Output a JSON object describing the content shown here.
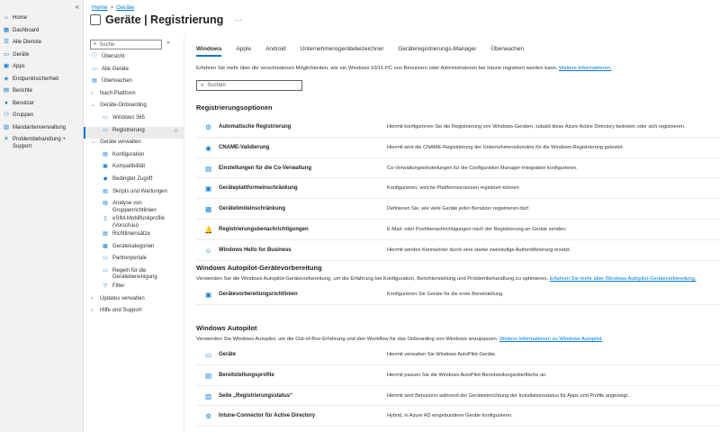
{
  "leftnav": {
    "items": [
      {
        "label": "Home",
        "icon": "home-icon",
        "glyph": "⌂"
      },
      {
        "label": "Dashboard",
        "icon": "dashboard-icon",
        "glyph": "▦"
      },
      {
        "label": "Alle Dienste",
        "icon": "all-services-icon",
        "glyph": "☰"
      },
      {
        "label": "Geräte",
        "icon": "devices-icon",
        "glyph": "▭"
      },
      {
        "label": "Apps",
        "icon": "apps-icon",
        "glyph": "▣"
      },
      {
        "label": "Endpunktsicherheit",
        "icon": "endpoint-security-icon",
        "glyph": "◈"
      },
      {
        "label": "Berichte",
        "icon": "reports-icon",
        "glyph": "▤"
      },
      {
        "label": "Benutzer",
        "icon": "users-icon",
        "glyph": "●"
      },
      {
        "label": "Gruppen",
        "icon": "groups-icon",
        "glyph": "⚇"
      },
      {
        "label": "Mandantenverwaltung",
        "icon": "tenant-admin-icon",
        "glyph": "▥"
      },
      {
        "label": "Problembehandlung + Support",
        "icon": "troubleshooting-icon",
        "glyph": "✕"
      }
    ]
  },
  "breadcrumb": {
    "home": "Home",
    "sep": ">",
    "current": "Geräte"
  },
  "page": {
    "title": "Geräte | Registrierung",
    "more": "···"
  },
  "subnav": {
    "search_placeholder": "Suche",
    "collapse": "«",
    "items": [
      {
        "label": "Übersicht",
        "icon": "overview-icon",
        "glyph": "ⓘ",
        "level": 1
      },
      {
        "label": "Alle Geräte",
        "icon": "all-devices-icon",
        "glyph": "▭",
        "level": 1
      },
      {
        "label": "Überwachen",
        "icon": "monitor-icon",
        "glyph": "▤",
        "level": 1
      },
      {
        "label": "Nach Plattform",
        "icon": "chevron-right-icon",
        "glyph": "›",
        "level": 1,
        "chev": true
      },
      {
        "label": "Geräte-Onboarding",
        "icon": "chevron-down-icon",
        "glyph": "⌄",
        "level": 1,
        "chev": true
      },
      {
        "label": "Windows 365",
        "icon": "windows365-icon",
        "glyph": "▭",
        "level": 2
      },
      {
        "label": "Registrierung",
        "icon": "enrollment-icon",
        "glyph": "▭",
        "level": 2,
        "selected": true,
        "star": "☆"
      },
      {
        "label": "Geräte verwalten",
        "icon": "chevron-down-icon",
        "glyph": "⌄",
        "level": 1,
        "chev": true
      },
      {
        "label": "Konfiguration",
        "icon": "configuration-icon",
        "glyph": "▤",
        "level": 2
      },
      {
        "label": "Kompatibilität",
        "icon": "compliance-icon",
        "glyph": "▣",
        "level": 2
      },
      {
        "label": "Bedingter Zugriff",
        "icon": "conditional-access-icon",
        "glyph": "◆",
        "level": 2
      },
      {
        "label": "Skripts und Wartungen",
        "icon": "scripts-icon",
        "glyph": "▤",
        "level": 2
      },
      {
        "label": "Analyse von Gruppenrichtlinien",
        "icon": "gpo-analytics-icon",
        "glyph": "▤",
        "level": 2
      },
      {
        "label": "eSIM-Mobilfunkprofile (Vorschau)",
        "icon": "esim-icon",
        "glyph": "▯",
        "level": 2
      },
      {
        "label": "Richtliniensätze",
        "icon": "policy-sets-icon",
        "glyph": "▤",
        "level": 2
      },
      {
        "label": "Gerätekategorien",
        "icon": "device-categories-icon",
        "glyph": "▦",
        "level": 2
      },
      {
        "label": "Partnerportale",
        "icon": "partner-portals-icon",
        "glyph": "▭",
        "level": 2
      },
      {
        "label": "Regeln für die Gerätebereinigung",
        "icon": "cleanup-rules-icon",
        "glyph": "▭",
        "level": 2
      },
      {
        "label": "Filter",
        "icon": "filter-icon",
        "glyph": "▽",
        "level": 2
      },
      {
        "label": "Updates verwalten",
        "icon": "chevron-right-icon",
        "glyph": "›",
        "level": 1,
        "chev": true
      },
      {
        "label": "Hilfe und Support",
        "icon": "chevron-right-icon",
        "glyph": "›",
        "level": 1,
        "chev": true
      }
    ]
  },
  "tabs": [
    {
      "label": "Windows",
      "active": true
    },
    {
      "label": "Apple"
    },
    {
      "label": "Android"
    },
    {
      "label": "Unternehmensgerätebezeichner"
    },
    {
      "label": "Geräteregistrierungs-Manager"
    },
    {
      "label": "Überwachen"
    }
  ],
  "intro": {
    "text": "Erfahren Sie mehr über die verschiedenen Möglichkeiten, wie ein Windows 10/11-PC von Benutzern oder Administratoren bei Intune registriert werden kann. ",
    "link": "Weitere Informationen."
  },
  "content_search": {
    "placeholder": "Suchen"
  },
  "sections": [
    {
      "title": "Registrierungsoptionen",
      "rows": [
        {
          "name": "Automatische Registrierung",
          "desc": "Hiermit konfigurieren Sie die Registrierung von Windows-Geräten, sobald diese Azure Active Directory beitreten oder sich registrieren.",
          "icon": "auto-enroll-icon",
          "glyph": "⚙"
        },
        {
          "name": "CNAME-Validierung",
          "desc": "Hiermit wird die CNAME-Registrierung der Unternehmensdomäne für die Windows-Registrierung getestet.",
          "icon": "cname-icon",
          "glyph": "◉"
        },
        {
          "name": "Einstellungen für die Co-Verwaltung",
          "desc": "Co-Verwaltungseinstellungen für die Configuration Manager-Integration konfigurieren.",
          "icon": "co-management-icon",
          "glyph": "▤"
        },
        {
          "name": "Geräteplattformeinschränkung",
          "desc": "Konfigurieren, welche Plattformversionen registriert können",
          "icon": "platform-restriction-icon",
          "glyph": "▣"
        },
        {
          "name": "Gerätelimiteinschränkung",
          "desc": "Definieren Sie, wie viele Geräte jeder Benutzer registrieren darf",
          "icon": "device-limit-icon",
          "glyph": "▦"
        },
        {
          "name": "Registrierungsbenachrichtigungen",
          "desc": "E-Mail- oder Pushbenachrichtigungen nach der Registrierung an Geräte senden.",
          "icon": "notification-icon",
          "glyph": "🔔"
        },
        {
          "name": "Windows Hello for Business",
          "desc": "Hiermit werden Kennwörter durch eine starke zweistufige Authentifizierung ersetzt.",
          "icon": "windows-hello-icon",
          "glyph": "☺"
        }
      ]
    },
    {
      "title": "Windows Autopilot-Gerätevorbereitung",
      "desc": "Verwenden Sie die Windows Autopilot-Gerätevorbereitung, um die Erfahrung bei Konfiguration, Berichterstellung und Problembehandlung zu optimieren. ",
      "link": "Erfahren Sie mehr über Windows Autopilot-Gerätevorbereitung.",
      "rows": [
        {
          "name": "Gerätevorbereitungsrichtlinien",
          "desc": "Konfigurieren Sie Geräte für die erste Bereitstellung.",
          "icon": "device-prep-policy-icon",
          "glyph": "▣"
        }
      ]
    },
    {
      "title": "Windows Autopilot",
      "desc": "Verwenden Sie Windows Autopilot, um die Out-of-Box-Erfahrung und den Workflow für das Onboarding von Windows anzupassen. ",
      "link": "Weitere Informationen zu Windows Autopilot",
      "rows": [
        {
          "name": "Geräte",
          "desc": "Hiermit verwalten Sie Windows AutoPilot-Geräte.",
          "icon": "autopilot-devices-icon",
          "glyph": "▭"
        },
        {
          "name": "Bereitstellungsprofile",
          "desc": "Hiermit passen Sie die Windows AutoPilot-Bereitstellungsoberfläche an.",
          "icon": "deployment-profiles-icon",
          "glyph": "▤"
        },
        {
          "name": "Seite „Registrierungsstatus“",
          "desc": "Hiermit wird Benutzern während der Geräteeinrichtung der Installationsstatus für Apps und Profile angezeigt.",
          "icon": "enrollment-status-icon",
          "glyph": "▥"
        },
        {
          "name": "Intune-Connector für Active Directory",
          "desc": "Hybrid, in Azure AD eingebundene Geräte konfigurieren.",
          "icon": "connector-icon",
          "glyph": "⚙"
        }
      ]
    }
  ]
}
